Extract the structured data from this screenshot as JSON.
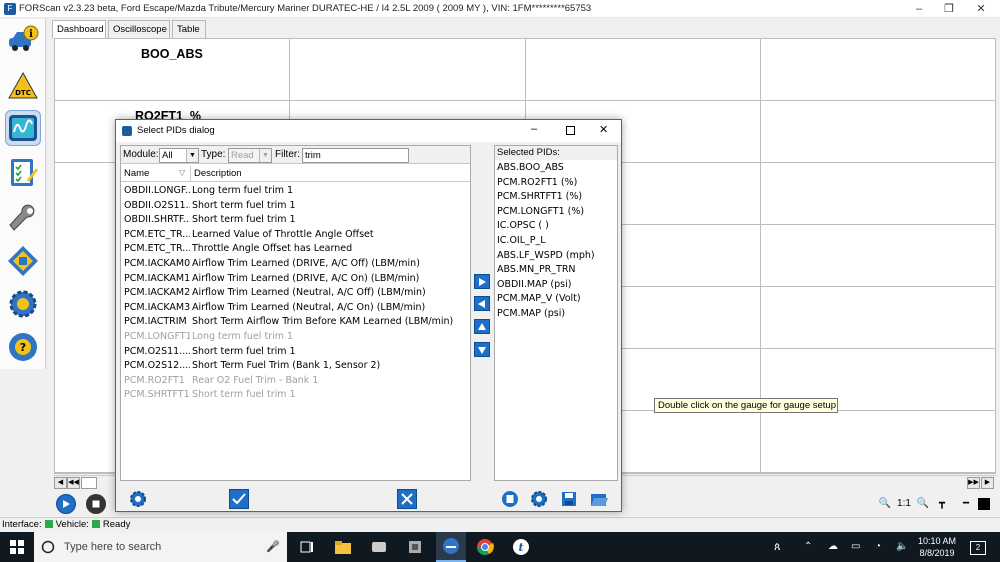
{
  "window": {
    "title": "FORScan v2.3.23 beta, Ford Escape/Mazda Tribute/Mercury Mariner DURATEC-HE / I4 2.5L 2009 ( 2009 MY ), VIN: 1FM*********65753",
    "minimize": "–",
    "maximize": "❐",
    "close": "✕"
  },
  "tabs": [
    {
      "label": "Dashboard",
      "active": true
    },
    {
      "label": "Oscilloscope",
      "active": false
    },
    {
      "label": "Table",
      "active": false
    }
  ],
  "gauges": [
    {
      "label": "BOO_ABS"
    },
    {
      "label": "RO2FT1_%"
    }
  ],
  "tooltip": "Double click on the gauge for gauge setup",
  "zoom_label": "1:1",
  "status": {
    "interface_label": "Interface:",
    "vehicle_label": "Vehicle:",
    "state": "Ready",
    "indicator_color": "#2da84a"
  },
  "dialog": {
    "title": "Select PIDs dialog",
    "module_label": "Module:",
    "module_value": "All",
    "type_label": "Type:",
    "type_value": "Read",
    "filter_label": "Filter:",
    "filter_value": "trim",
    "col_name": "Name",
    "col_description": "Description",
    "available_pids": [
      {
        "name": "OBDII.LONGF...",
        "description": "Long term fuel trim 1",
        "disabled": false
      },
      {
        "name": "OBDII.O2S11...",
        "description": "Short term fuel trim 1",
        "disabled": false
      },
      {
        "name": "OBDII.SHRTF...",
        "description": "Short term fuel trim 1",
        "disabled": false
      },
      {
        "name": "PCM.ETC_TR...",
        "description": "Learned Value of Throttle Angle Offset",
        "disabled": false
      },
      {
        "name": "PCM.ETC_TR...",
        "description": "Throttle Angle Offset has Learned",
        "disabled": false
      },
      {
        "name": "PCM.IACKAM0",
        "description": "Airflow Trim Learned (DRIVE, A/C Off) (LBM/min)",
        "disabled": false
      },
      {
        "name": "PCM.IACKAM1",
        "description": "Airflow Trim Learned (DRIVE, A/C On) (LBM/min)",
        "disabled": false
      },
      {
        "name": "PCM.IACKAM2",
        "description": "Airflow Trim Learned (Neutral, A/C Off) (LBM/min)",
        "disabled": false
      },
      {
        "name": "PCM.IACKAM3",
        "description": "Airflow Trim Learned (Neutral, A/C On) (LBM/min)",
        "disabled": false
      },
      {
        "name": "PCM.IACTRIM",
        "description": "Short Term Airflow Trim Before KAM Learned (LBM/min)",
        "disabled": false
      },
      {
        "name": "PCM.LONGFT1",
        "description": "Long term fuel trim 1",
        "disabled": true
      },
      {
        "name": "PCM.O2S11....",
        "description": "Short term fuel trim 1",
        "disabled": false
      },
      {
        "name": "PCM.O2S12....",
        "description": "Short Term Fuel Trim (Bank 1, Sensor 2)",
        "disabled": false
      },
      {
        "name": "PCM.RO2FT1",
        "description": "Rear O2 Fuel Trim - Bank 1",
        "disabled": true
      },
      {
        "name": "PCM.SHRTFT1",
        "description": "Short term fuel trim 1",
        "disabled": true
      }
    ],
    "selected_label": "Selected PIDs:",
    "selected_pids": [
      "ABS.BOO_ABS",
      "PCM.RO2FT1 (%)",
      "PCM.SHRTFT1 (%)",
      "PCM.LONGFT1 (%)",
      "IC.OPSC ( )",
      "IC.OIL_P_L",
      "ABS.LF_WSPD (mph)",
      "ABS.MN_PR_TRN",
      "OBDII.MAP (psi)",
      "PCM.MAP_V (Volt)",
      "PCM.MAP (psi)"
    ]
  },
  "taskbar": {
    "search_placeholder": "Type here to search",
    "time": "10:10 AM",
    "date": "8/8/2019",
    "notifications": "2"
  }
}
